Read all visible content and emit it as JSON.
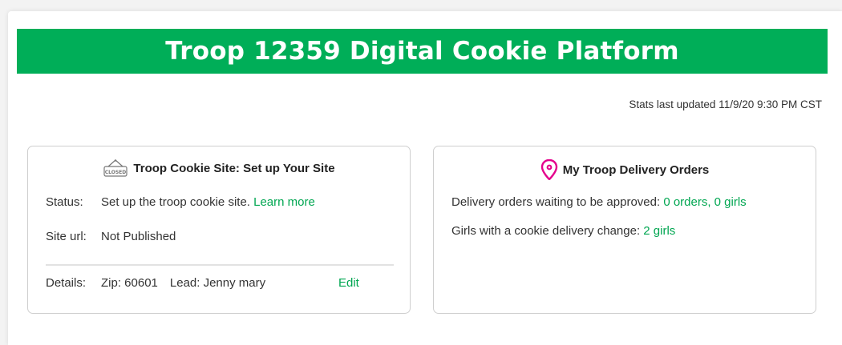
{
  "banner": {
    "title": "Troop 12359 Digital Cookie Platform"
  },
  "stats": {
    "text": "Stats last updated 11/9/20 9:30 PM CST"
  },
  "site_card": {
    "title": "Troop Cookie Site: Set up Your Site",
    "icon": "closed-sign-icon",
    "icon_text": "CLOSED",
    "status_label": "Status:",
    "status_value": "Set up the troop cookie site.",
    "status_link": "Learn more",
    "url_label": "Site url:",
    "url_value": "Not Published",
    "details_label": "Details:",
    "zip_text": "Zip: 60601",
    "lead_text": "Lead: Jenny mary",
    "edit_label": "Edit"
  },
  "delivery_card": {
    "title": "My Troop Delivery Orders",
    "icon": "location-pin-icon",
    "waiting_label": "Delivery orders waiting to be approved:",
    "waiting_link": "0 orders, 0 girls",
    "change_label": "Girls with a cookie delivery change:",
    "change_link": "2 girls"
  },
  "colors": {
    "brand_green": "#00ae58",
    "link_green": "#00a651",
    "pin_pink": "#e4008c"
  }
}
